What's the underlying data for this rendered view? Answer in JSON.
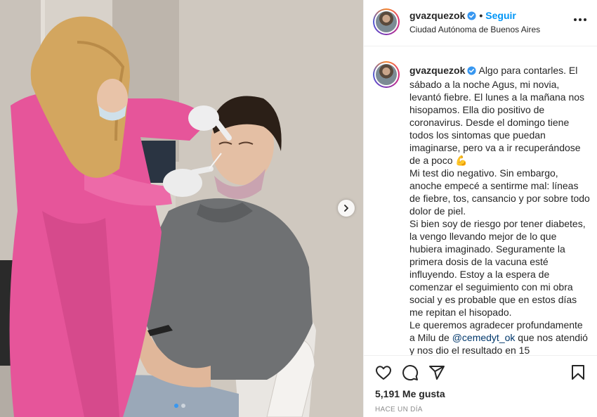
{
  "post": {
    "username": "gvazquezok",
    "follow_label": "Seguir",
    "separator": "•",
    "location": "Ciudad Autónoma de Buenos Aires",
    "caption_lines": [
      "Algo para contarles. El sábado a la noche Agus, mi novia, levantó fiebre. El lunes a la mañana nos hisopamos. Ella dio positivo de coronavirus. Desde el domingo tiene todos los sintomas que puedan imaginarse, pero va a ir recuperándose de a poco 💪",
      "Mi test dio negativo. Sin embargo, anoche empecé a sentirme mal: líneas de fiebre, tos, cansancio y por sobre todo dolor de piel.",
      "Si bien soy de riesgo por tener diabetes, la vengo llevando mejor de lo que hubiera imaginado. Seguramente la primera dosis de la vacuna esté influyendo. Estoy a la espera de comenzar el seguimiento con mi obra social y es probable que en estos días me repitan el hisopado."
    ],
    "caption_last_before": "Le queremos agradecer profundamente a Milu de ",
    "caption_mention": "@cemedyt_ok",
    "caption_last_after": " que nos atendió y nos dio el resultado en 15",
    "likes": "5,191 Me gusta",
    "timestamp": "HACE UN DÍA",
    "carousel": {
      "total": 2,
      "current": 1
    }
  },
  "colors": {
    "follow_blue": "#0095f6",
    "verified_blue": "#3897f0",
    "text": "#262626",
    "muted": "#8e8e8e",
    "mention": "#00376b"
  },
  "icons": {
    "verified": "verified-badge-icon",
    "more": "more-options-icon",
    "like": "heart-icon",
    "comment": "comment-icon",
    "share": "paper-plane-icon",
    "save": "bookmark-icon",
    "next": "chevron-right-icon"
  }
}
